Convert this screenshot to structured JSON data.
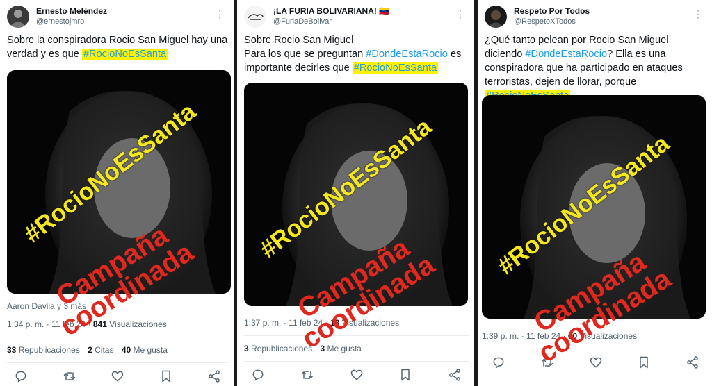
{
  "tweets": [
    {
      "display_name": "Ernesto Meléndez",
      "handle": "@ernestojmro",
      "text_before": "Sobre la conspiradora Rocio San Miguel hay una verdad y es que ",
      "text_line2": "",
      "hashtag_link": "",
      "text_after": "",
      "hashtag": "#RocioNoEsSanta",
      "liked_by": "Aaron Davila y 3 más",
      "time": "1:34 p. m.",
      "date": "11 feb 24",
      "views_count": "841",
      "views_label": "Visualizaciones",
      "reposts_count": "33",
      "reposts_label": "Republicaciones",
      "quotes_count": "2",
      "quotes_label": "Citas",
      "likes_count": "40",
      "likes_label": "Me gusta"
    },
    {
      "display_name": "¡LA FURIA BOLIVARIANA! 🇻🇪",
      "handle": "@FuriaDeBolivar",
      "text_before": "Sobre Rocio San Miguel",
      "text_line2": "Para los que se preguntan ",
      "hashtag_link": "#DondeEstaRocio",
      "text_after": " es importante decirles que ",
      "hashtag": "#RocioNoEsSanta",
      "time": "1:37 p. m.",
      "date": "11 feb 24",
      "views_count": "18",
      "views_label": "Visualizaciones",
      "reposts_count": "3",
      "reposts_label": "Republicaciones",
      "likes_count": "3",
      "likes_label": "Me gusta"
    },
    {
      "display_name": "Respeto Por Todos",
      "handle": "@RespetoXTodos",
      "text_before": "¿Qué tanto pelean por Rocio San Miguel diciendo ",
      "hashtag_link": "#DondeEstaRocio",
      "text_after": "? Ella es una conspiradora que ha participado en ataques terroristas, dejen de llorar, porque ",
      "hashtag": "#RocioNoEsSanta",
      "time": "1:39 p. m.",
      "date": "11 feb 24",
      "views_count": "60",
      "views_label": "Visualizaciones"
    }
  ],
  "overlay": {
    "hashtag": "#RocioNoEsSanta",
    "campaign_line1": "Campaña",
    "campaign_line2": "coordinada"
  },
  "colors": {
    "highlight": "#fff200",
    "link": "#1d9bf0",
    "overlay_yellow": "#f4e71c",
    "overlay_red": "#e0281f",
    "divider": "#1a1a1a"
  },
  "icons": [
    "reply-icon",
    "repost-icon",
    "like-icon",
    "bookmark-icon",
    "share-icon",
    "more-icon"
  ]
}
